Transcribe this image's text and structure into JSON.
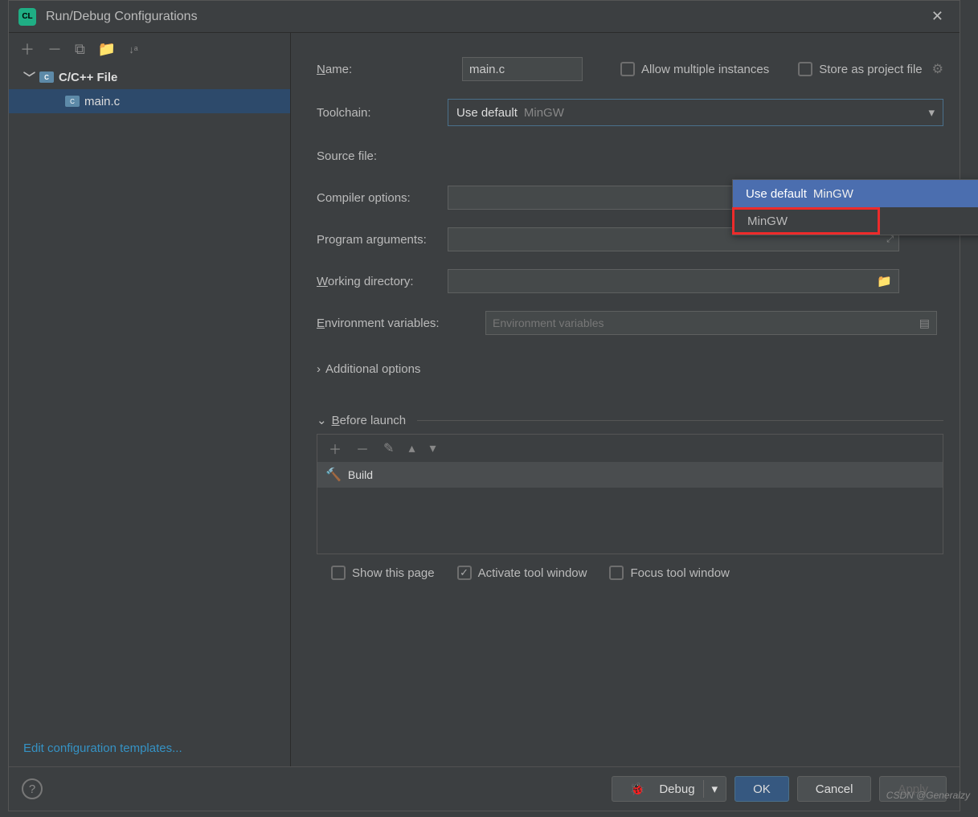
{
  "title": "Run/Debug Configurations",
  "tree": {
    "group": "C/C++ File",
    "item": "main.c"
  },
  "editTemplates": "Edit configuration templates...",
  "form": {
    "nameLabel": "Name:",
    "nameValue": "main.c",
    "allowMultiple": "Allow multiple instances",
    "storeProject": "Store as project file",
    "toolchainLabel": "Toolchain:",
    "toolchainValue": "Use default",
    "toolchainSecondary": "MinGW",
    "sourceFileLabel": "Source file:",
    "compilerLabel": "Compiler options:",
    "programArgsLabel": "Program arguments:",
    "workingDirLabel": "Working directory:",
    "envVarsLabel": "Environment variables:",
    "envPlaceholder": "Environment variables",
    "additionalOptions": "Additional options",
    "beforeLaunch": "Before launch",
    "buildTask": "Build",
    "showPage": "Show this page",
    "activateTool": "Activate tool window",
    "focusTool": "Focus tool window"
  },
  "dropdown": {
    "opt1a": "Use default",
    "opt1b": "MinGW",
    "opt2": "MinGW"
  },
  "footer": {
    "debug": "Debug",
    "ok": "OK",
    "cancel": "Cancel",
    "apply": "Apply"
  },
  "watermark": "CSDN @Generalzy"
}
